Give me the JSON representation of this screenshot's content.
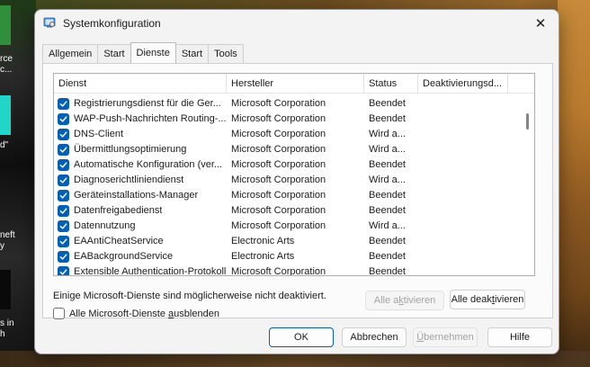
{
  "window": {
    "title": "Systemkonfiguration",
    "close_glyph": "✕"
  },
  "tabs": [
    {
      "label": "Allgemein",
      "active": false
    },
    {
      "label": "Start",
      "active": false
    },
    {
      "label": "Dienste",
      "active": true
    },
    {
      "label": "Start",
      "active": false
    },
    {
      "label": "Tools",
      "active": false
    }
  ],
  "list": {
    "columns": [
      "Dienst",
      "Hersteller",
      "Status",
      "Deaktivierungsd..."
    ],
    "rows": [
      {
        "name": "Registrierungsdienst für die Ger...",
        "vendor": "Microsoft Corporation",
        "status": "Beendet",
        "deact": "",
        "checked": true
      },
      {
        "name": "WAP-Push-Nachrichten Routing-...",
        "vendor": "Microsoft Corporation",
        "status": "Beendet",
        "deact": "",
        "checked": true
      },
      {
        "name": "DNS-Client",
        "vendor": "Microsoft Corporation",
        "status": "Wird a...",
        "deact": "",
        "checked": true
      },
      {
        "name": "Übermittlungsoptimierung",
        "vendor": "Microsoft Corporation",
        "status": "Wird a...",
        "deact": "",
        "checked": true
      },
      {
        "name": "Automatische Konfiguration (ver...",
        "vendor": "Microsoft Corporation",
        "status": "Beendet",
        "deact": "",
        "checked": true
      },
      {
        "name": "Diagnoserichtliniendienst",
        "vendor": "Microsoft Corporation",
        "status": "Wird a...",
        "deact": "",
        "checked": true
      },
      {
        "name": "Geräteinstallations-Manager",
        "vendor": "Microsoft Corporation",
        "status": "Beendet",
        "deact": "",
        "checked": true
      },
      {
        "name": "Datenfreigabedienst",
        "vendor": "Microsoft Corporation",
        "status": "Beendet",
        "deact": "",
        "checked": true
      },
      {
        "name": "Datennutzung",
        "vendor": "Microsoft Corporation",
        "status": "Wird a...",
        "deact": "",
        "checked": true
      },
      {
        "name": "EAAntiCheatService",
        "vendor": "Electronic Arts",
        "status": "Beendet",
        "deact": "",
        "checked": true
      },
      {
        "name": "EABackgroundService",
        "vendor": "Electronic Arts",
        "status": "Beendet",
        "deact": "",
        "checked": true
      },
      {
        "name": "Extensible Authentication-Protokoll",
        "vendor": "Microsoft Corporation",
        "status": "Beendet",
        "deact": "",
        "checked": true
      }
    ]
  },
  "info_text": "Einige Microsoft-Dienste sind möglicherweise nicht deaktiviert.",
  "buttons": {
    "enable_all": {
      "pre": "Alle a",
      "accel": "k",
      "post": "tivieren"
    },
    "disable_all": {
      "pre": "Alle deak",
      "accel": "t",
      "post": "ivieren"
    },
    "ok": "OK",
    "cancel": "Abbrechen",
    "apply": {
      "pre": "",
      "accel": "Ü",
      "post": "bernehmen"
    },
    "help": "Hilfe"
  },
  "hide_ms": {
    "pre": "Alle Microsoft-Dienste ",
    "accel": "a",
    "post": "usblenden",
    "checked": false
  },
  "desktop": {
    "left_fragments": [
      "rce",
      "c...",
      "d\"",
      "neft",
      "y",
      "s in",
      "h"
    ]
  },
  "colors": {
    "accent": "#005fb8",
    "dialog_bg": "#f3f3f3"
  }
}
